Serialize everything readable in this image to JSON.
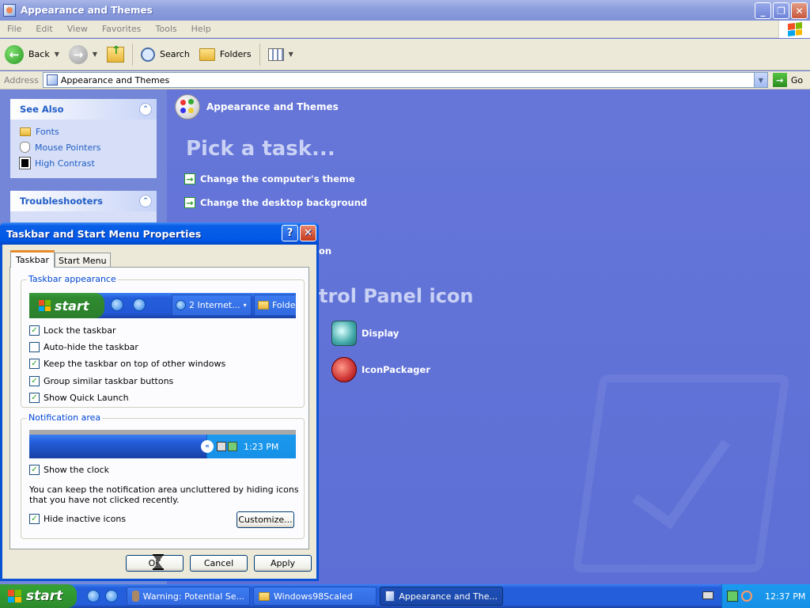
{
  "window": {
    "title": "Appearance and Themes"
  },
  "menu": [
    "File",
    "Edit",
    "View",
    "Favorites",
    "Tools",
    "Help"
  ],
  "toolbar": {
    "back": "Back",
    "search": "Search",
    "folders": "Folders"
  },
  "address": {
    "label": "Address",
    "value": "Appearance and Themes",
    "go": "Go"
  },
  "sidebar": {
    "see_also": {
      "title": "See Also",
      "items": [
        "Fonts",
        "Mouse Pointers",
        "High Contrast"
      ]
    },
    "troubleshooters": {
      "title": "Troubleshooters"
    }
  },
  "main": {
    "header": "Appearance and Themes",
    "pick_task": "Pick a task...",
    "tasks": [
      "Change the computer's theme",
      "Change the desktop background"
    ],
    "partial_task": "on",
    "partial_heading": "trol Panel icon",
    "icons": [
      "Display",
      "IconPackager"
    ]
  },
  "dialog": {
    "title": "Taskbar and Start Menu Properties",
    "tabs": [
      "Taskbar",
      "Start Menu"
    ],
    "taskbar_appearance": {
      "label": "Taskbar appearance",
      "preview_start": "start",
      "preview_buttons": [
        "2 Internet...",
        "Folde"
      ],
      "options": [
        {
          "label": "Lock the taskbar",
          "checked": true
        },
        {
          "label": "Auto-hide the taskbar",
          "checked": false
        },
        {
          "label": "Keep the taskbar on top of other windows",
          "checked": true
        },
        {
          "label": "Group similar taskbar buttons",
          "checked": true
        },
        {
          "label": "Show Quick Launch",
          "checked": true
        }
      ]
    },
    "notification_area": {
      "label": "Notification area",
      "preview_time": "1:23 PM",
      "show_clock": {
        "label": "Show the clock",
        "checked": true
      },
      "description": "You can keep the notification area uncluttered by hiding icons that you have not clicked recently.",
      "hide_inactive": {
        "label": "Hide inactive icons",
        "checked": true
      },
      "customize": "Customize..."
    },
    "buttons": {
      "ok": "OK",
      "cancel": "Cancel",
      "apply": "Apply"
    }
  },
  "taskbar": {
    "start": "start",
    "tasks": [
      "Warning: Potential Se...",
      "Windows98Scaled",
      "Appearance and The..."
    ],
    "clock": "12:37 PM"
  },
  "colors": {
    "xp_blue": "#245edb",
    "start_green": "#32a032",
    "panel_blue": "#6375d6"
  }
}
